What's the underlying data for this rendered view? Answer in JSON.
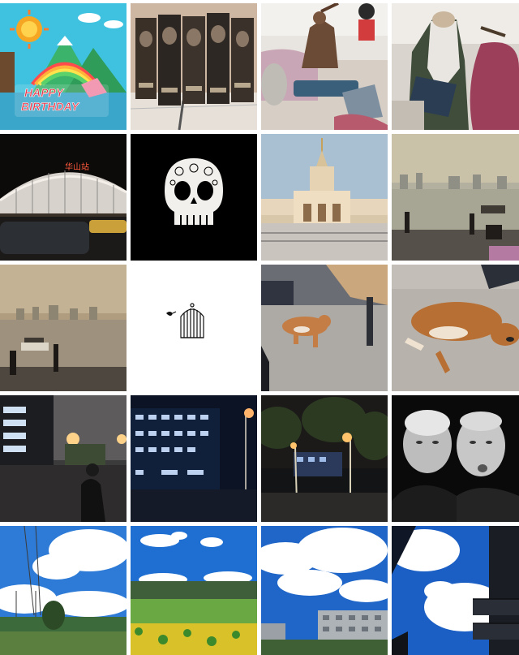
{
  "gallery": {
    "birthday_sign": "HAPPY BIRTHDAY",
    "birthday_line1": "HAPPY",
    "birthday_line2": "BIRTHDAY",
    "stadium_sign": "华山站"
  }
}
